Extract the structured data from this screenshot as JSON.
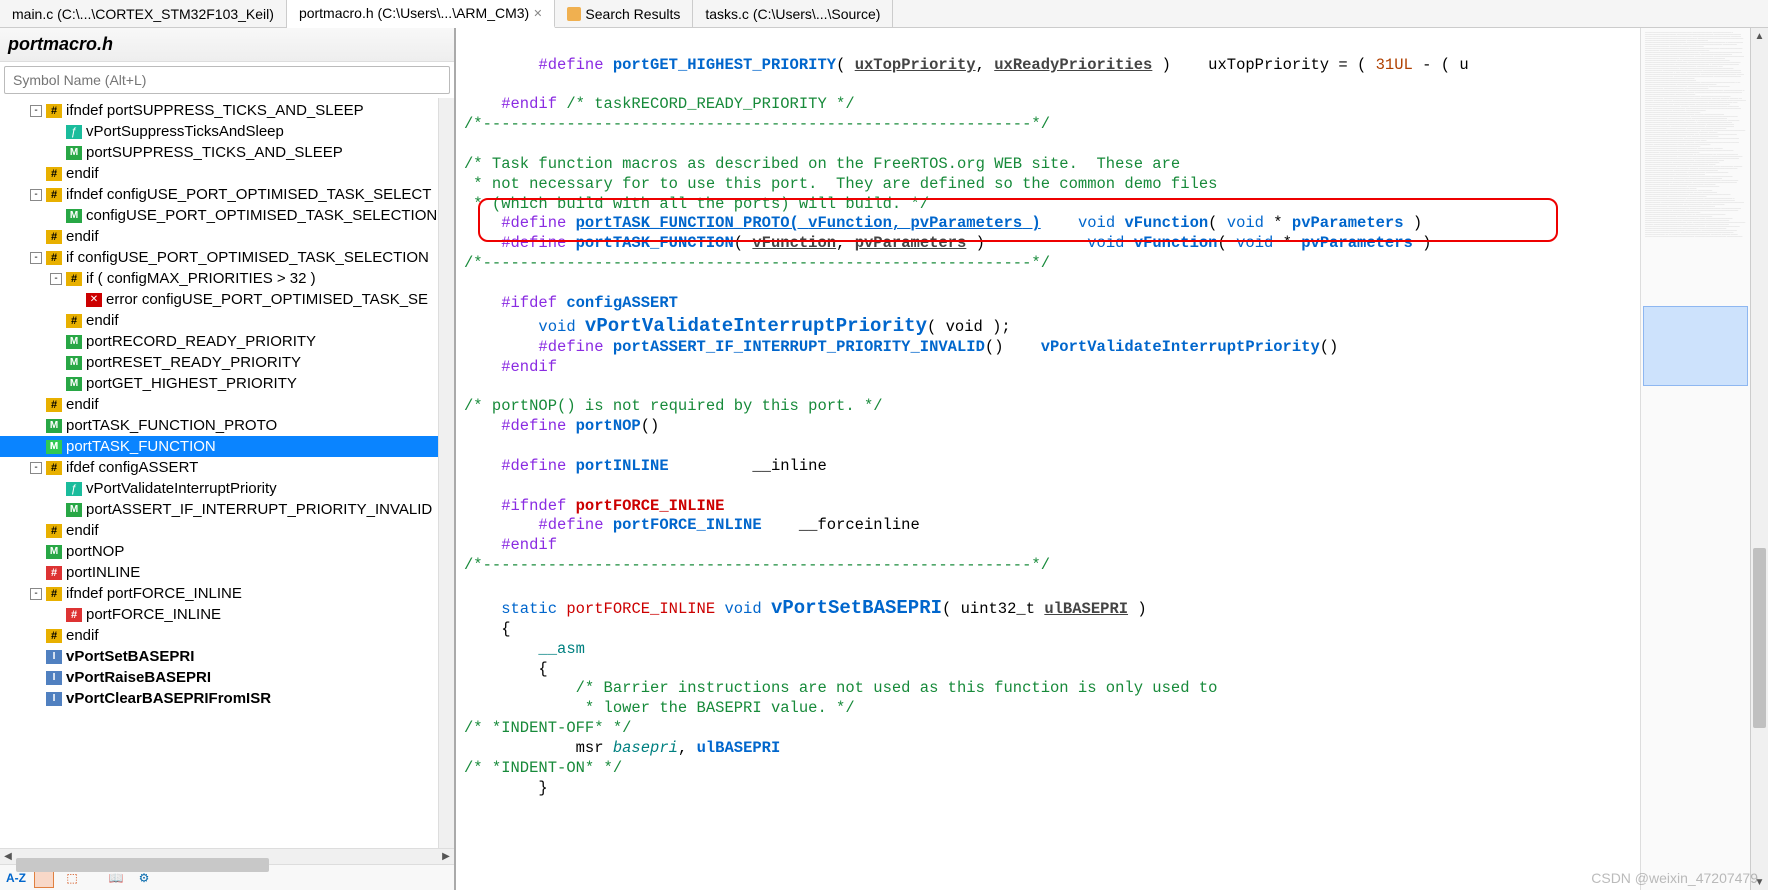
{
  "tabs": [
    {
      "label": "main.c (C:\\...\\CORTEX_STM32F103_Keil)",
      "active": false,
      "closable": false
    },
    {
      "label": "portmacro.h (C:\\Users\\...\\ARM_CM3)",
      "active": true,
      "closable": true
    },
    {
      "label": "Search Results",
      "active": false,
      "icon": "search"
    },
    {
      "label": "tasks.c (C:\\Users\\...\\Source)",
      "active": false
    }
  ],
  "sidebar": {
    "title": "portmacro.h",
    "search_placeholder": "Symbol Name (Alt+L)",
    "items": [
      {
        "depth": 1,
        "exp": "-",
        "icon": "pound-ylw",
        "label": "ifndef portSUPPRESS_TICKS_AND_SLEEP"
      },
      {
        "depth": 2,
        "icon": "fn-cyan",
        "label": "vPortSuppressTicksAndSleep"
      },
      {
        "depth": 2,
        "icon": "m-grn",
        "label": "portSUPPRESS_TICKS_AND_SLEEP"
      },
      {
        "depth": 1,
        "icon": "pound-ylw",
        "label": "endif"
      },
      {
        "depth": 1,
        "exp": "-",
        "icon": "pound-ylw",
        "label": "ifndef configUSE_PORT_OPTIMISED_TASK_SELECT"
      },
      {
        "depth": 2,
        "icon": "m-grn",
        "label": "configUSE_PORT_OPTIMISED_TASK_SELECTION"
      },
      {
        "depth": 1,
        "icon": "pound-ylw",
        "label": "endif"
      },
      {
        "depth": 1,
        "exp": "-",
        "icon": "pound-ylw",
        "label": "if configUSE_PORT_OPTIMISED_TASK_SELECTION"
      },
      {
        "depth": 2,
        "exp": "-",
        "icon": "pound-ylw",
        "label": "if ( configMAX_PRIORITIES > 32 )"
      },
      {
        "depth": 3,
        "icon": "x-red",
        "label": "error configUSE_PORT_OPTIMISED_TASK_SE"
      },
      {
        "depth": 2,
        "icon": "pound-ylw",
        "label": "endif"
      },
      {
        "depth": 2,
        "icon": "m-grn",
        "label": "portRECORD_READY_PRIORITY"
      },
      {
        "depth": 2,
        "icon": "m-grn",
        "label": "portRESET_READY_PRIORITY"
      },
      {
        "depth": 2,
        "icon": "m-grn",
        "label": "portGET_HIGHEST_PRIORITY"
      },
      {
        "depth": 1,
        "icon": "pound-ylw",
        "label": "endif"
      },
      {
        "depth": 1,
        "icon": "m-grn",
        "label": "portTASK_FUNCTION_PROTO"
      },
      {
        "depth": 1,
        "icon": "m-grn",
        "label": "portTASK_FUNCTION",
        "selected": true
      },
      {
        "depth": 1,
        "exp": "-",
        "icon": "pound-ylw",
        "label": "ifdef configASSERT"
      },
      {
        "depth": 2,
        "icon": "fn-cyan",
        "label": "vPortValidateInterruptPriority"
      },
      {
        "depth": 2,
        "icon": "m-grn",
        "label": "portASSERT_IF_INTERRUPT_PRIORITY_INVALID"
      },
      {
        "depth": 1,
        "icon": "pound-ylw",
        "label": "endif"
      },
      {
        "depth": 1,
        "icon": "m-grn",
        "label": "portNOP"
      },
      {
        "depth": 1,
        "icon": "pound-red",
        "label": "portINLINE"
      },
      {
        "depth": 1,
        "exp": "-",
        "icon": "pound-ylw",
        "label": "ifndef portFORCE_INLINE"
      },
      {
        "depth": 2,
        "icon": "pound-red",
        "label": "portFORCE_INLINE"
      },
      {
        "depth": 1,
        "icon": "pound-ylw",
        "label": "endif"
      },
      {
        "depth": 1,
        "icon": "fn-blue",
        "label": "vPortSetBASEPRI",
        "bold": true
      },
      {
        "depth": 1,
        "icon": "fn-blue",
        "label": "vPortRaiseBASEPRI",
        "bold": true
      },
      {
        "depth": 1,
        "icon": "fn-blue",
        "label": "vPortClearBASEPRIFromISR",
        "bold": true
      }
    ]
  },
  "toolbar": {
    "az": "A-Z"
  },
  "code": {
    "l1_a": "        #define ",
    "l1_b": "portGET_HIGHEST_PRIORITY",
    "l1_c": "( ",
    "l1_d": "uxTopPriority",
    "l1_e": ", ",
    "l1_f": "uxReadyPriorities",
    "l1_g": " )    uxTopPriority = ( ",
    "l1_h": "31UL",
    "l1_i": " - ( u",
    "l2": "",
    "l3_a": "    #endif",
    "l3_b": " /* taskRECORD_READY_PRIORITY */",
    "l4": "/*-----------------------------------------------------------*/",
    "l5": "",
    "l6": "/* Task function macros as described on the FreeRTOS.org WEB site.  These are",
    "l7": " * not necessary for to use this port.  They are defined so the common demo files",
    "l8": " * (which build with all the ports) will build. */",
    "l9_a": "    #define ",
    "l9_b": "portTASK_FUNCTION_PROTO( ",
    "l9_c": "vFunction",
    "l9_d": ", ",
    "l9_e": "pvParameters",
    "l9_f": " )",
    "l9_g": "    void",
    "l9_h": " vFunction",
    "l9_i": "( ",
    "l9_j": "void",
    "l9_k": " * ",
    "l9_l": "pvParameters",
    "l9_m": " )",
    "l10_a": "    #define ",
    "l10_b": "portTASK_FUNCTION",
    "l10_c": "( ",
    "l10_d": "vFunction",
    "l10_e": ", ",
    "l10_f": "pvParameters",
    "l10_g": " )",
    "l10_h": "           void",
    "l10_i": " vFunction",
    "l10_j": "( ",
    "l10_k": "void",
    "l10_l": " * ",
    "l10_m": "pvParameters",
    "l10_n": " )",
    "l11": "/*-----------------------------------------------------------*/",
    "l12": "",
    "l13_a": "    #ifdef ",
    "l13_b": "configASSERT",
    "l14_a": "        void ",
    "l14_b": "vPortValidateInterruptPriority",
    "l14_c": "( void );",
    "l15_a": "        #define ",
    "l15_b": "portASSERT_IF_INTERRUPT_PRIORITY_INVALID",
    "l15_c": "()    ",
    "l15_d": "vPortValidateInterruptPriority",
    "l15_e": "()",
    "l16": "    #endif",
    "l17": "",
    "l18": "/* portNOP() is not required by this port. */",
    "l19_a": "    #define ",
    "l19_b": "portNOP",
    "l19_c": "()",
    "l20": "",
    "l21_a": "    #define ",
    "l21_b": "portINLINE",
    "l21_c": "         __inline",
    "l22": "",
    "l23_a": "    #ifndef ",
    "l23_b": "portFORCE_INLINE",
    "l24_a": "        #define ",
    "l24_b": "portFORCE_INLINE",
    "l24_c": "    __forceinline",
    "l25": "    #endif",
    "l26": "/*-----------------------------------------------------------*/",
    "l27": "",
    "l28_a": "    static ",
    "l28_b": "portFORCE_INLINE",
    "l28_c": " void ",
    "l28_d": "vPortSetBASEPRI",
    "l28_e": "( uint32_t ",
    "l28_f": "ulBASEPRI",
    "l28_g": " )",
    "l29": "    {",
    "l30": "        __asm",
    "l31": "        {",
    "l32": "            /* Barrier instructions are not used as this function is only used to",
    "l33": "             * lower the BASEPRI value. */",
    "l34": "/* *INDENT-OFF* */",
    "l35_a": "            msr ",
    "l35_b": "basepri",
    "l35_c": ", ",
    "l35_d": "ulBASEPRI",
    "l36": "/* *INDENT-ON* */",
    "l37": "        }"
  },
  "watermark": "CSDN @weixin_47207479"
}
